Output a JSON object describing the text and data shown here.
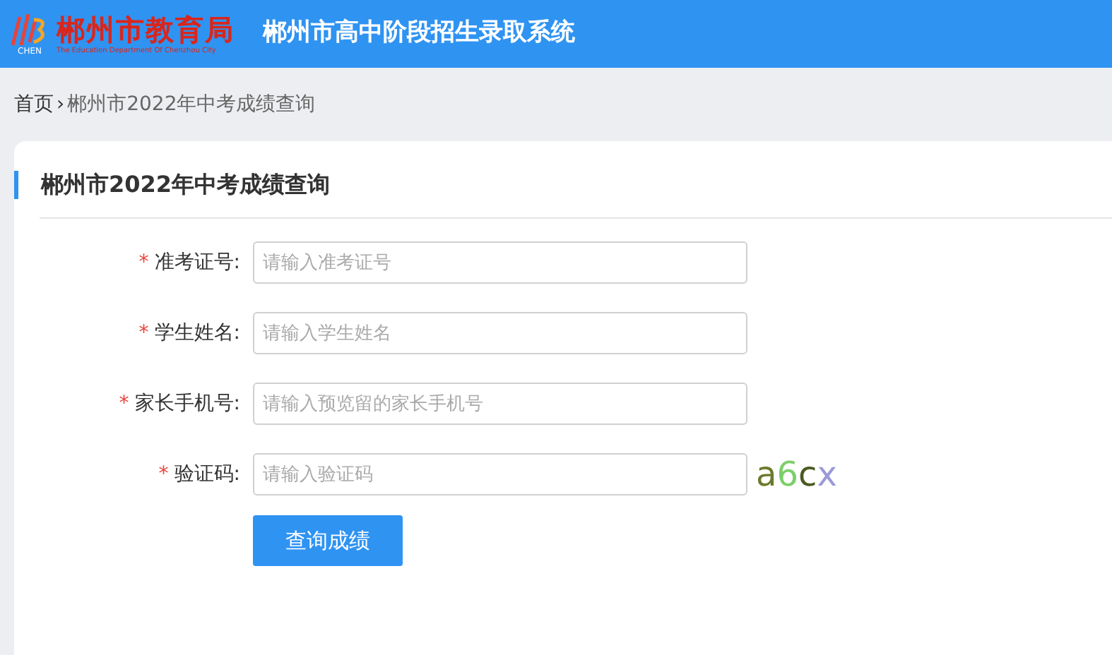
{
  "header": {
    "logo_mark": "CHEN",
    "logo_title": "郴州市教育局",
    "logo_subtitle": "The Education Department Of Chenzhou City",
    "system_title": "郴州市高中阶段招生录取系统"
  },
  "breadcrumb": {
    "home": "首页",
    "separator": "›",
    "current": "郴州市2022年中考成绩查询"
  },
  "card": {
    "title": "郴州市2022年中考成绩查询"
  },
  "form": {
    "fields": [
      {
        "label": "准考证号:",
        "required_mark": "*",
        "placeholder": "请输入准考证号",
        "kind": "text"
      },
      {
        "label": "学生姓名:",
        "required_mark": "*",
        "placeholder": "请输入学生姓名",
        "kind": "text"
      },
      {
        "label": "家长手机号:",
        "required_mark": "*",
        "placeholder": "请输入预览留的家长手机号",
        "kind": "text"
      },
      {
        "label": "验证码:",
        "required_mark": "*",
        "placeholder": "请输入验证码",
        "kind": "captcha"
      }
    ],
    "captcha": [
      {
        "char": "a",
        "color": "#6b7a2a"
      },
      {
        "char": "6",
        "color": "#7ccf6a"
      },
      {
        "char": "c",
        "color": "#4a5a20"
      },
      {
        "char": "x",
        "color": "#9a9ad8"
      }
    ],
    "submit": "查询成绩"
  }
}
